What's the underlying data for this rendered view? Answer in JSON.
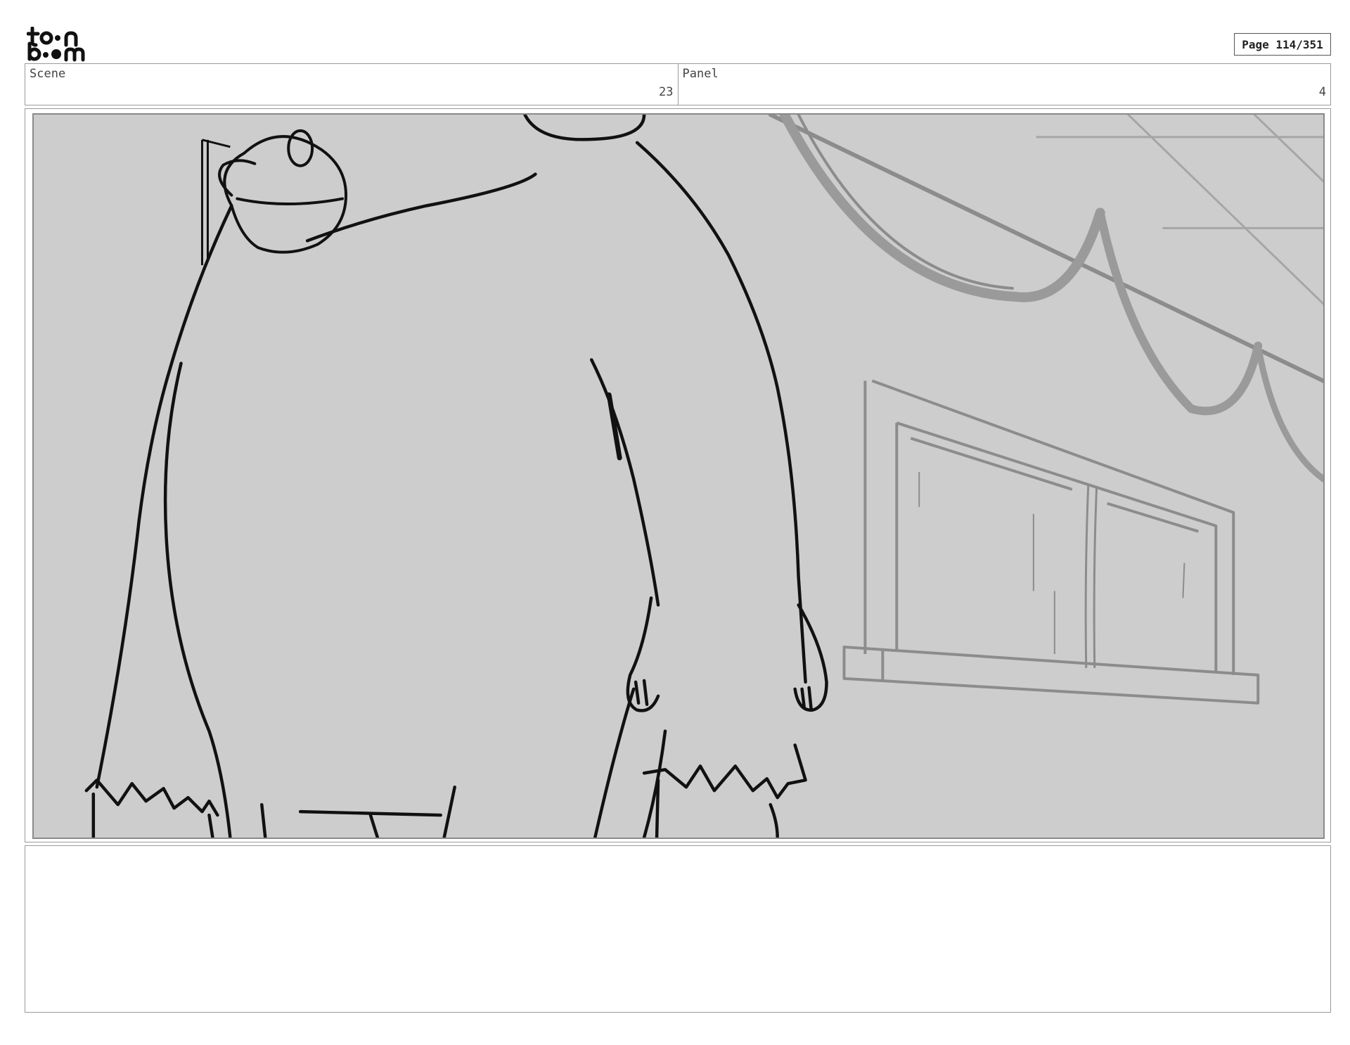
{
  "header": {
    "logo_icon": "toonboom-logo-icon",
    "page_label": "Page 114/351"
  },
  "info": {
    "scene_label": "Scene",
    "scene_value": "23",
    "panel_label": "Panel",
    "panel_value": "4"
  },
  "panel": {
    "background_color": "#cdcdcd",
    "line_color": "#111111",
    "background_line_color": "#8c8c8c"
  },
  "notes": {
    "text": ""
  }
}
